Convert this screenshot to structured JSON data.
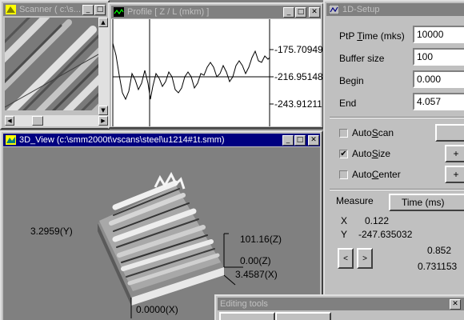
{
  "scanner": {
    "title": "Scanner ( c:\\s..."
  },
  "profile": {
    "title": "Profile [ Z / L (mkm) ]",
    "values": [
      "-175.709490",
      "-216.951480",
      "-243.912115"
    ]
  },
  "setup": {
    "title": "1D-Setup",
    "fields": [
      {
        "label": "PtP Time (mks)",
        "value": "10000"
      },
      {
        "label": "Buffer size",
        "value": "100"
      },
      {
        "label": "Begin",
        "value": "0.000"
      },
      {
        "label": "End",
        "value": "4.057"
      }
    ],
    "checkboxes": [
      {
        "label": "AutoScan",
        "checked": false
      },
      {
        "label": "AutoSize",
        "checked": true
      },
      {
        "label": "AutoCenter",
        "checked": false
      }
    ],
    "tabs": [
      "Measure",
      "Time (ms)"
    ],
    "measure": {
      "x_label": "X",
      "x_value": "0.122",
      "y_label": "Y",
      "y_value": "-247.635032",
      "val1": "0.852",
      "val2": "0.731153"
    }
  },
  "view3d": {
    "title": "3D_View (c:\\smm2000t\\vscans\\steel\\u1214#1t.smm)",
    "y_label": "3.2959(Y)",
    "z_max_label": "101.16(Z)",
    "z_min_label": "0.00(Z)",
    "x_max_label": "3.4587(X)",
    "x_min_label": "0.0000(X)"
  },
  "editing": {
    "title": "Editing tools"
  },
  "colors": {
    "title_active": "#000080",
    "title_inactive": "#808080",
    "face": "#c0c0c0",
    "desktop": "#808080"
  }
}
